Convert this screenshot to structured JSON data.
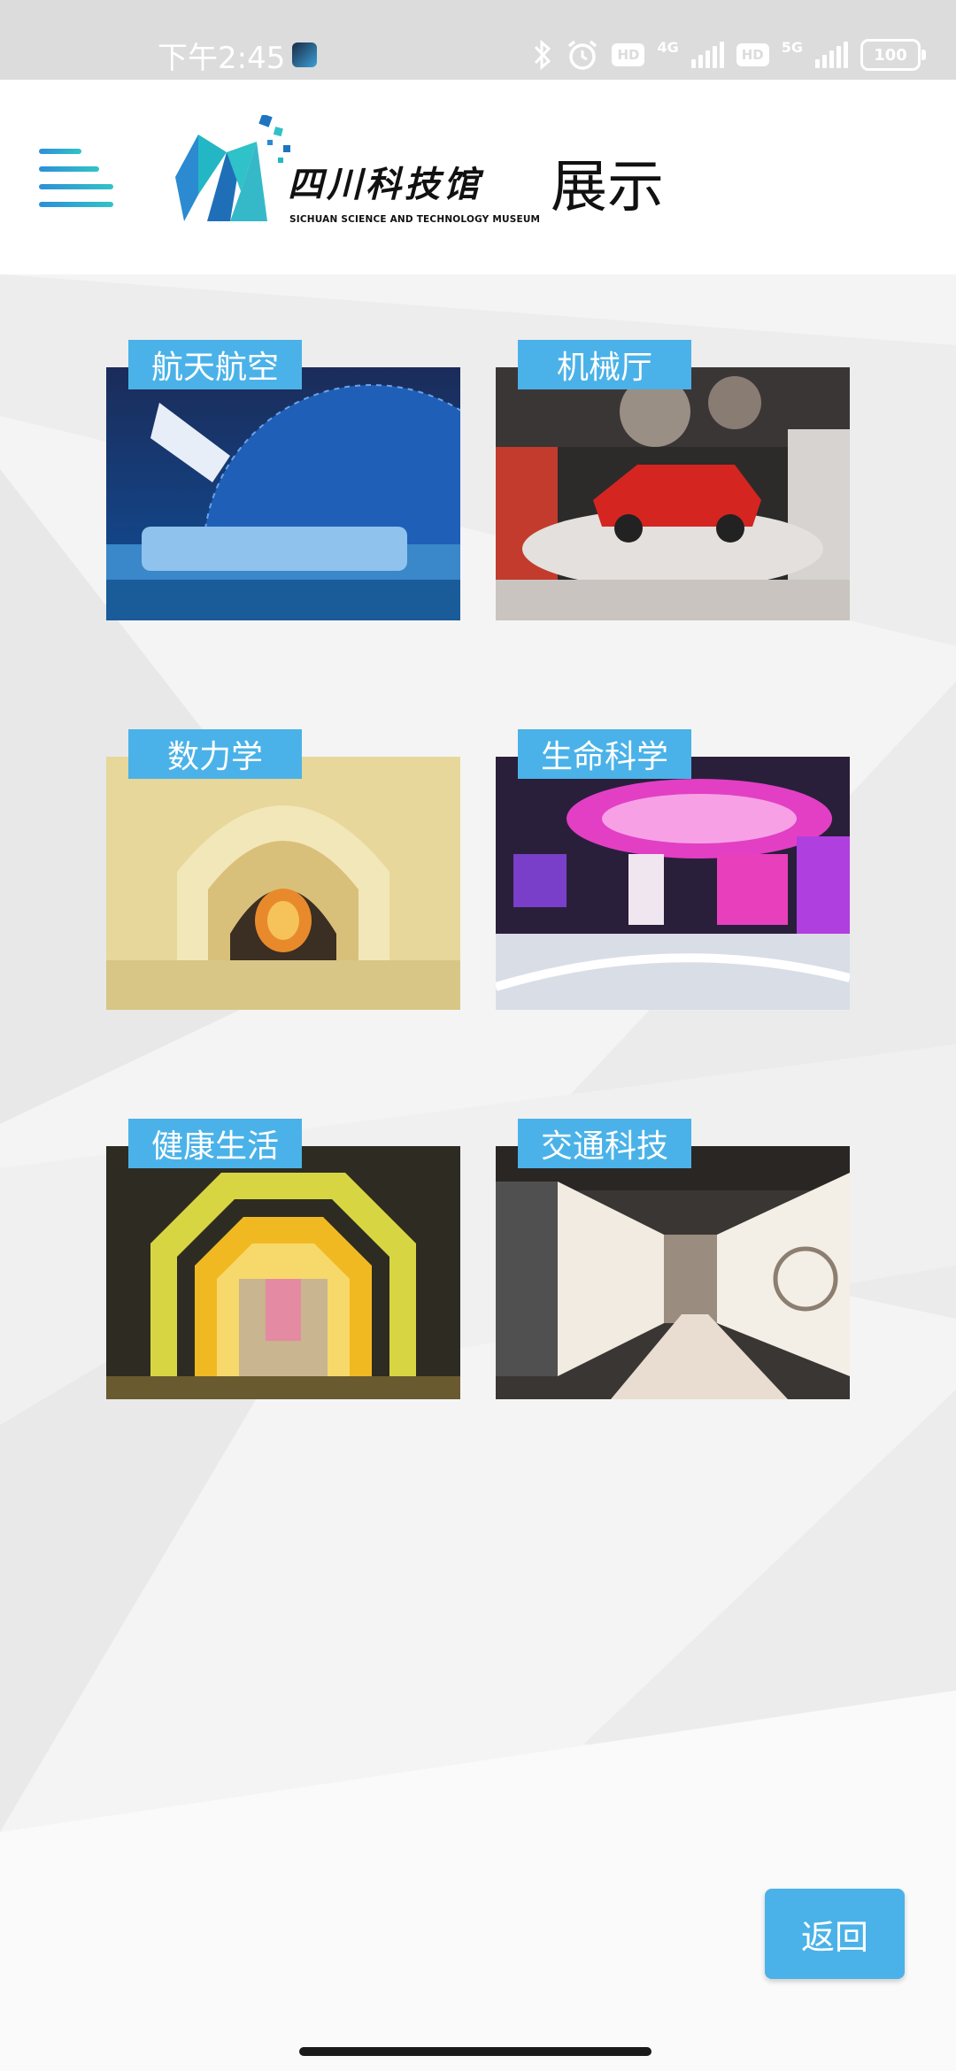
{
  "status_bar": {
    "time": "下午2:45",
    "network_1": "4G",
    "network_2": "5G",
    "hd_label": "HD",
    "battery": "100"
  },
  "header": {
    "logo_cn": "四川科技馆",
    "logo_en": "SICHUAN SCIENCE AND TECHNOLOGY MUSEUM",
    "title": "展示"
  },
  "exhibits": [
    {
      "label": "航天航空",
      "image": "aerospace-hall-photo"
    },
    {
      "label": "机械厅",
      "image": "machinery-hall-photo"
    },
    {
      "label": "数力学",
      "image": "mathematics-mechanics-hall-photo"
    },
    {
      "label": "生命科学",
      "image": "life-science-hall-photo"
    },
    {
      "label": "健康生活",
      "image": "healthy-life-hall-photo"
    },
    {
      "label": "交通科技",
      "image": "transport-technology-hall-photo"
    }
  ],
  "back_label": "返回",
  "colors": {
    "accent": "#4ab2e8",
    "status_bar": "#dcdcdc"
  }
}
